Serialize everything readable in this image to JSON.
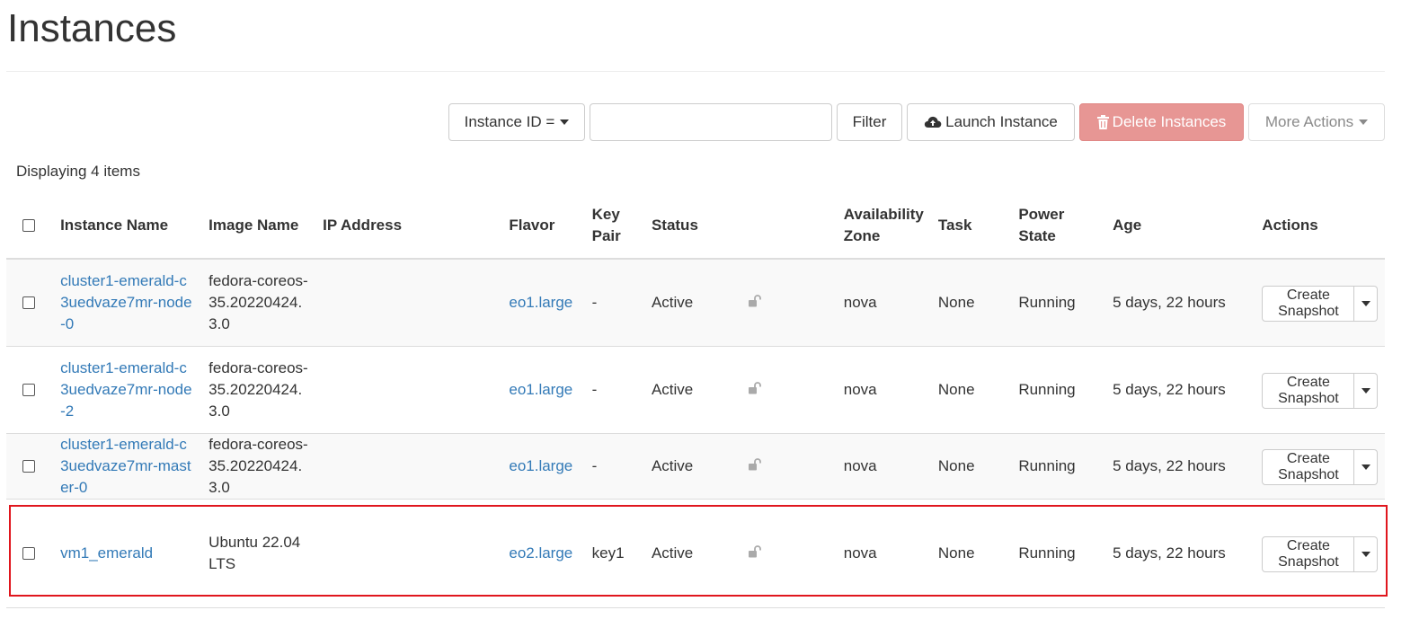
{
  "page": {
    "title": "Instances"
  },
  "toolbar": {
    "filter_field_label": "Instance ID =",
    "search_value": "",
    "filter_label": "Filter",
    "launch_label": "Launch Instance",
    "delete_label": "Delete Instances",
    "more_actions_label": "More Actions"
  },
  "table": {
    "count_text": "Displaying 4 items",
    "columns": [
      "Instance Name",
      "Image Name",
      "IP Address",
      "Flavor",
      "Key Pair",
      "Status",
      "Availability Zone",
      "Task",
      "Power State",
      "Age",
      "Actions"
    ],
    "rows": [
      {
        "name": "cluster1-emerald-c3uedvaze7mr-node-0",
        "image": "fedora-coreos-35.20220424.3.0",
        "ip": "",
        "flavor": "eo1.large",
        "key_pair": "-",
        "status": "Active",
        "az": "nova",
        "task": "None",
        "power": "Running",
        "age": "5 days, 22 hours",
        "action": "Create Snapshot"
      },
      {
        "name": "cluster1-emerald-c3uedvaze7mr-node-2",
        "image": "fedora-coreos-35.20220424.3.0",
        "ip": "",
        "flavor": "eo1.large",
        "key_pair": "-",
        "status": "Active",
        "az": "nova",
        "task": "None",
        "power": "Running",
        "age": "5 days, 22 hours",
        "action": "Create Snapshot"
      },
      {
        "name": "cluster1-emerald-c3uedvaze7mr-master-0",
        "image": "fedora-coreos-35.20220424.3.0",
        "ip": "",
        "flavor": "eo1.large",
        "key_pair": "-",
        "status": "Active",
        "az": "nova",
        "task": "None",
        "power": "Running",
        "age": "5 days, 22 hours",
        "action": "Create Snapshot"
      },
      {
        "name": "vm1_emerald",
        "image": "Ubuntu 22.04 LTS",
        "ip": "",
        "flavor": "eo2.large",
        "key_pair": "key1",
        "status": "Active",
        "az": "nova",
        "task": "None",
        "power": "Running",
        "age": "5 days, 22 hours",
        "action": "Create Snapshot"
      }
    ]
  },
  "colors": {
    "link": "#337ab7",
    "danger_disabled": "#e79694",
    "highlight_border": "#e0161d",
    "row_stripe": "#f9f9f9"
  },
  "icons": {
    "launch": "cloud-upload-icon",
    "delete": "trash-icon",
    "status_lock": "unlocked-padlock-icon",
    "caret": "caret-down-icon"
  }
}
